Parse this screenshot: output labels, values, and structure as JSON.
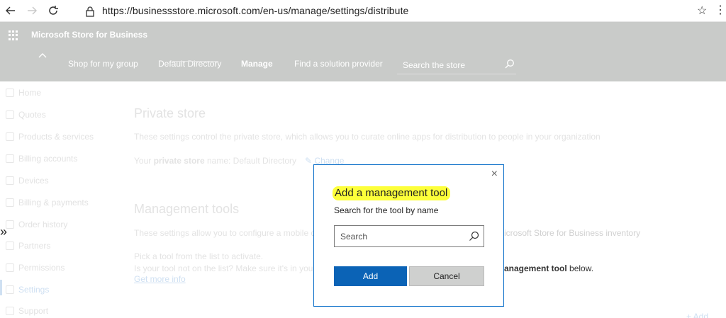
{
  "browser": {
    "url": "https://businessstore.microsoft.com/en-us/manage/settings/distribute",
    "back_icon": "arrow-left-icon",
    "forward_icon": "arrow-right-icon",
    "refresh_icon": "refresh-icon",
    "lock_icon": "lock-icon",
    "favorite_icon": "star-icon",
    "more_icon": "more-icon"
  },
  "header": {
    "brand": "Microsoft Store for Business",
    "nav": [
      {
        "label": "Shop for my group"
      },
      {
        "label": "Default Directory"
      },
      {
        "label": "Manage"
      },
      {
        "label": "Find a solution provider"
      }
    ],
    "search_placeholder": "Search the store"
  },
  "sidebar": {
    "items": [
      {
        "label": "Home"
      },
      {
        "label": "Quotes"
      },
      {
        "label": "Products & services"
      },
      {
        "label": "Billing accounts"
      },
      {
        "label": "Devices"
      },
      {
        "label": "Billing & payments"
      },
      {
        "label": "Order history"
      },
      {
        "label": "Partners"
      },
      {
        "label": "Permissions"
      },
      {
        "label": "Settings"
      },
      {
        "label": "Support"
      }
    ],
    "expand_glyph": "»"
  },
  "main": {
    "private_store": {
      "title": "Private store",
      "description": "These settings control the private store, which allows you to curate online apps for distribution to people in your organization",
      "name_prefix": "Your",
      "name_bold": "private store",
      "name_suffix": "name: Default Directory",
      "change_link": "Change"
    },
    "management_tools": {
      "title": "Management tools",
      "description_left": "These settings allow you to configure a mobile de",
      "description_right": "icrosoft Store for Business inventory",
      "pick_text": "Pick a tool from the list to activate.",
      "not_listed_left": "Is your tool not on the list? Make sure it's in your",
      "not_listed_bold": "anagement tool",
      "not_listed_right": "below.",
      "more_info_link": "Get more info"
    },
    "add_link": "+ Add"
  },
  "dialog": {
    "title": "Add a management tool",
    "subtitle": "Search for the tool by name",
    "search_placeholder": "Search",
    "add_label": "Add",
    "cancel_label": "Cancel",
    "close_glyph": "×"
  },
  "colors": {
    "accent": "#0b63b6",
    "highlight": "#fdff3a",
    "header_bg": "#c9cbc9"
  }
}
